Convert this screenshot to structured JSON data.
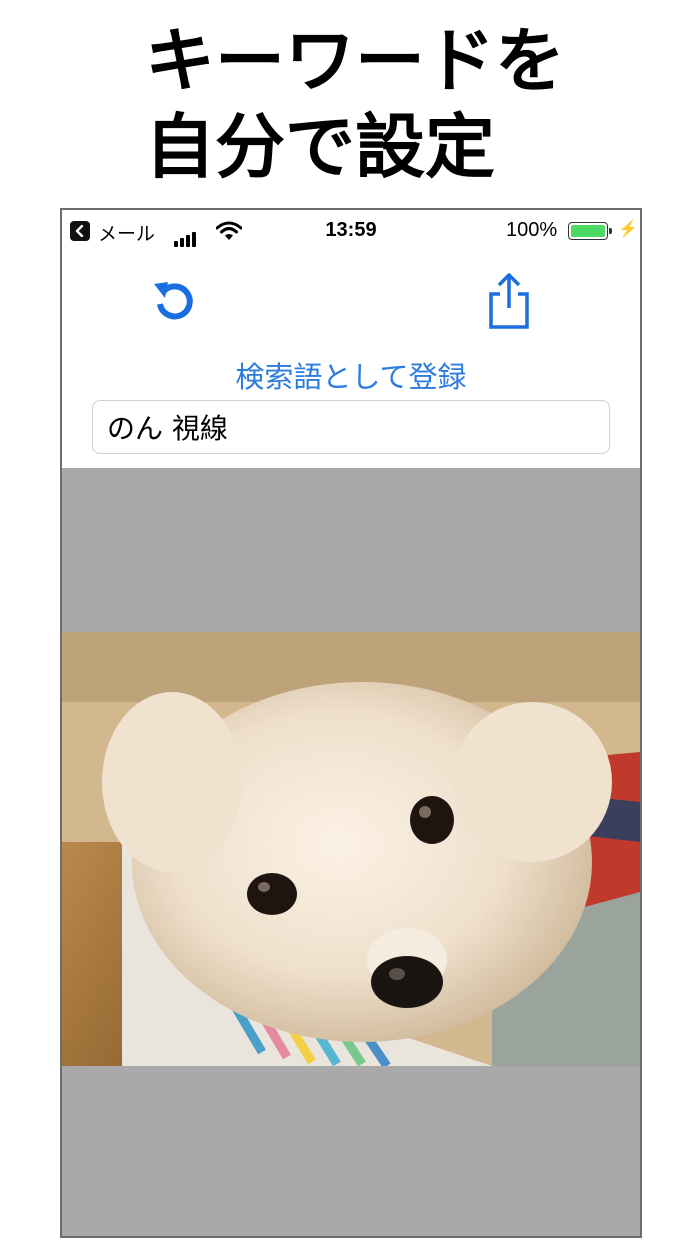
{
  "headline": {
    "line1": "キーワードを",
    "line2": "自分で設定"
  },
  "status_bar": {
    "back_app": "メール",
    "time": "13:59",
    "battery_percent": "100%",
    "battery_level": 1.0
  },
  "toolbar": {
    "reload_icon": "rotate-counterclockwise-icon",
    "share_icon": "share-icon"
  },
  "register_link": "検索語として登録",
  "search": {
    "value": "のん 視線"
  },
  "colors": {
    "accent": "#2b7cde",
    "viewer_background": "#a9a9a9",
    "battery_fill": "#4cd964"
  },
  "image": {
    "subject": "dog-photo"
  }
}
